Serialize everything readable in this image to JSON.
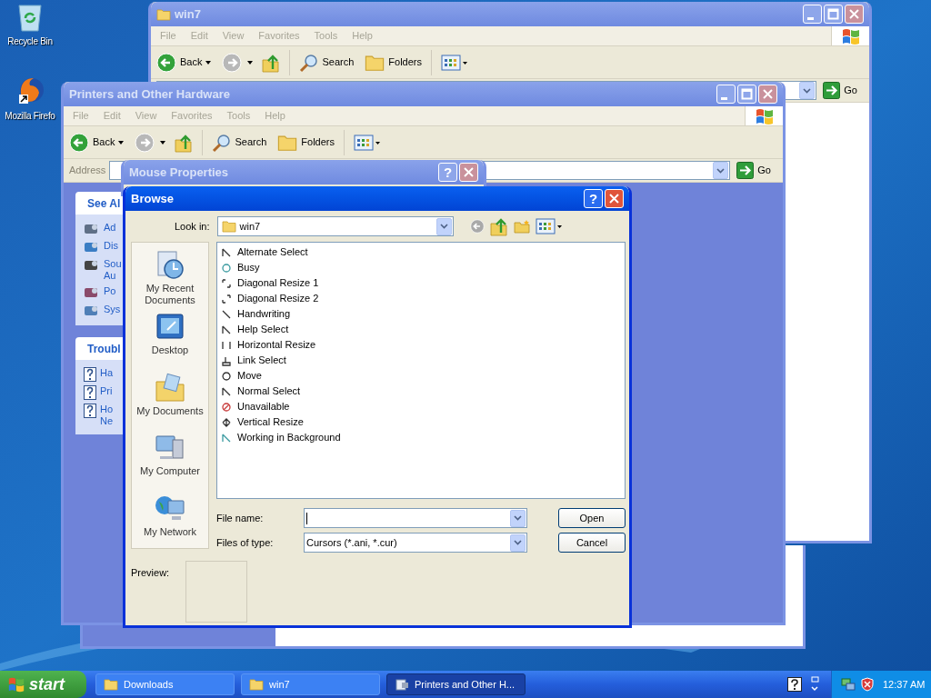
{
  "desktop_icons": [
    {
      "label": "Recycle Bin",
      "kind": "recycle"
    },
    {
      "label": "Mozilla Firefo",
      "kind": "browser"
    }
  ],
  "win7_window": {
    "title": "win7",
    "menu": [
      "File",
      "Edit",
      "View",
      "Favorites",
      "Tools",
      "Help"
    ],
    "toolbar": {
      "back": "Back",
      "search": "Search",
      "folders": "Folders"
    },
    "go": "Go"
  },
  "printers_window": {
    "title": "Printers and Other Hardware",
    "menu": [
      "File",
      "Edit",
      "View",
      "Favorites",
      "Tools",
      "Help"
    ],
    "toolbar": {
      "back": "Back",
      "search": "Search",
      "folders": "Folders"
    },
    "address_label": "Address",
    "go": "Go",
    "task_panes": [
      {
        "title": "See Al",
        "kind": "links",
        "items": [
          {
            "lines": [
              "Ad"
            ]
          },
          {
            "lines": [
              "Dis"
            ]
          },
          {
            "lines": [
              "Sou",
              "Au"
            ]
          },
          {
            "lines": [
              "Po"
            ]
          },
          {
            "lines": [
              "Sys"
            ]
          }
        ]
      },
      {
        "title": "Troubl",
        "kind": "help",
        "items": [
          {
            "lines": [
              "Ha"
            ]
          },
          {
            "lines": [
              "Pri"
            ]
          },
          {
            "lines": [
              "Ho",
              "Ne"
            ]
          }
        ]
      }
    ]
  },
  "mouse_properties": {
    "title": "Mouse Properties",
    "help": "?"
  },
  "browse": {
    "title": "Browse",
    "help": "?",
    "look_in_label": "Look in:",
    "look_in_value": "win7",
    "places": [
      {
        "label": "My Recent Documents",
        "kind": "recent"
      },
      {
        "label": "Desktop",
        "kind": "desktop"
      },
      {
        "label": "My Documents",
        "kind": "documents"
      },
      {
        "label": "My Computer",
        "kind": "computer"
      },
      {
        "label": "My Network",
        "kind": "network"
      }
    ],
    "files": [
      "Alternate Select",
      "Busy",
      "Diagonal Resize 1",
      "Diagonal Resize 2",
      "Handwriting",
      "Help Select",
      "Horizontal Resize",
      "Link Select",
      "Move",
      "Normal Select",
      "Unavailable",
      "Vertical Resize",
      "Working in Background"
    ],
    "file_name_label": "File name:",
    "files_of_type_label": "Files of type:",
    "files_of_type_value": "Cursors (*.ani, *.cur)",
    "open": "Open",
    "cancel": "Cancel",
    "preview_label": "Preview:"
  },
  "taskbar": {
    "start": "start",
    "tasks": [
      {
        "label": "Downloads",
        "selected": false
      },
      {
        "label": "win7",
        "selected": false
      },
      {
        "label": "Printers and Other H...",
        "selected": true
      }
    ],
    "clock": "12:37 AM"
  }
}
